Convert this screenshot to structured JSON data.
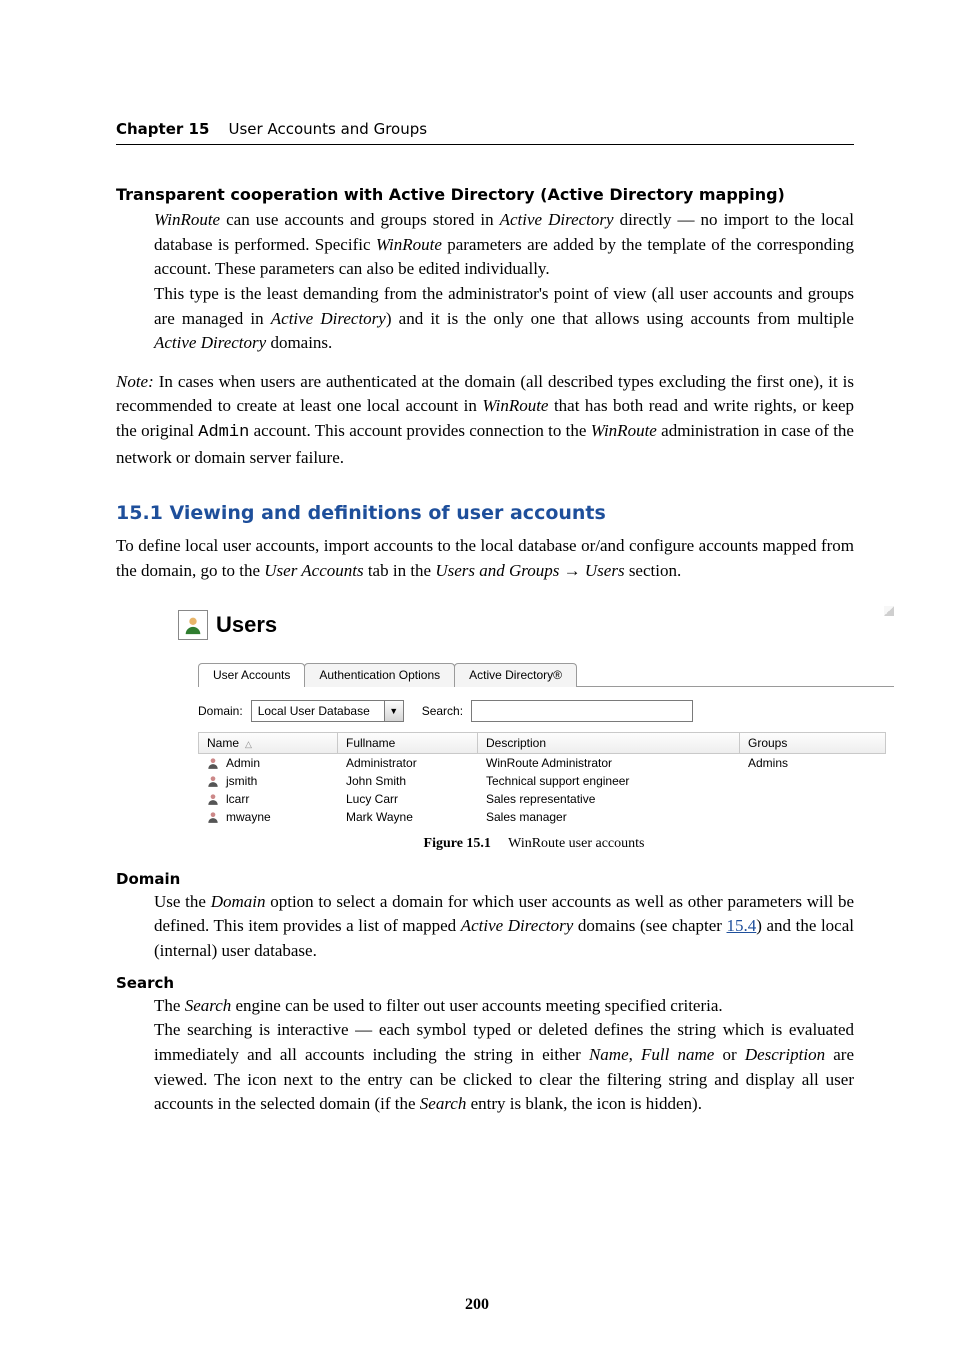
{
  "run_head": {
    "chapter": "Chapter 15",
    "title": "User Accounts and Groups"
  },
  "h_transparent": "Transparent cooperation with Active Directory (Active Directory mapping)",
  "p1a": "WinRoute",
  "p1b": " can use accounts and groups stored in ",
  "p1c": "Active Directory",
  "p1d": " directly — no import to the local database is performed. Specific ",
  "p1e": "WinRoute",
  "p1f": " parameters are added by the template of the corresponding account. These parameters can also be edited individually.",
  "p2a": "This type is the least demanding from the administrator's point of view (all user accounts and groups are managed in ",
  "p2b": "Active Directory",
  "p2c": ") and it is the only one that allows using accounts from multiple ",
  "p2d": "Active Directory",
  "p2e": " domains.",
  "note_a": "Note:",
  "note_b": " In cases when users are authenticated at the domain (all described types excluding the first one), it is recommended to create at least one local account in ",
  "note_c": "WinRoute",
  "note_d": " that has both read and write rights, or keep the original ",
  "note_e": "Admin",
  "note_f": " account. This account provides connection to the ",
  "note_g": "WinRoute",
  "note_h": " administration in case of the network or domain server failure.",
  "sec_heading": "15.1  Viewing and definitions of user accounts",
  "sec_p_a": "To define local user accounts, import accounts to the local database or/and configure accounts mapped from the domain, go to the ",
  "sec_p_b": "User Accounts",
  "sec_p_c": " tab in the ",
  "sec_p_d": "Users and Groups",
  "sec_p_arrow": " → ",
  "sec_p_e": "Users",
  "sec_p_f": " section.",
  "fig": {
    "panel_title": "Users",
    "tabs": [
      "User Accounts",
      "Authentication Options",
      "Active Directory®"
    ],
    "domain_label": "Domain:",
    "domain_value": "Local User Database",
    "search_label": "Search:",
    "search_value": "",
    "cols": [
      "Name",
      "Fullname",
      "Description",
      "Groups"
    ],
    "rows": [
      {
        "name": "Admin",
        "full": "Administrator",
        "desc": "WinRoute Administrator",
        "groups": "Admins"
      },
      {
        "name": "jsmith",
        "full": "John Smith",
        "desc": "Technical support engineer",
        "groups": ""
      },
      {
        "name": "lcarr",
        "full": "Lucy Carr",
        "desc": "Sales representative",
        "groups": ""
      },
      {
        "name": "mwayne",
        "full": "Mark Wayne",
        "desc": "Sales manager",
        "groups": ""
      }
    ],
    "caption_b": "Figure 15.1",
    "caption_t": "WinRoute user accounts"
  },
  "dl": {
    "domain_t": "Domain",
    "domain_a": "Use the ",
    "domain_b": "Domain",
    "domain_c": " option to select a domain for which user accounts as well as other parameters will be defined. This item provides a list of mapped ",
    "domain_d": "Active Directory",
    "domain_e": " domains (see chapter ",
    "domain_link": "15.4",
    "domain_f": ") and the local (internal) user database.",
    "search_t": "Search",
    "search_a": "The ",
    "search_b": "Search",
    "search_c": " engine can be used to filter out user accounts meeting specified criteria.",
    "search_d": "The searching is interactive — each symbol typed or deleted defines the string which is evaluated immediately and all accounts including the string in either ",
    "search_e": "Name",
    "search_f": ", ",
    "search_g": "Full name",
    "search_h": " or ",
    "search_i": "Description",
    "search_j": " are viewed. The icon next to the entry can be clicked to clear the filtering string and display all user accounts in the selected domain (if the ",
    "search_k": "Search",
    "search_l": " entry is blank, the icon is hidden)."
  },
  "page_number": "200"
}
